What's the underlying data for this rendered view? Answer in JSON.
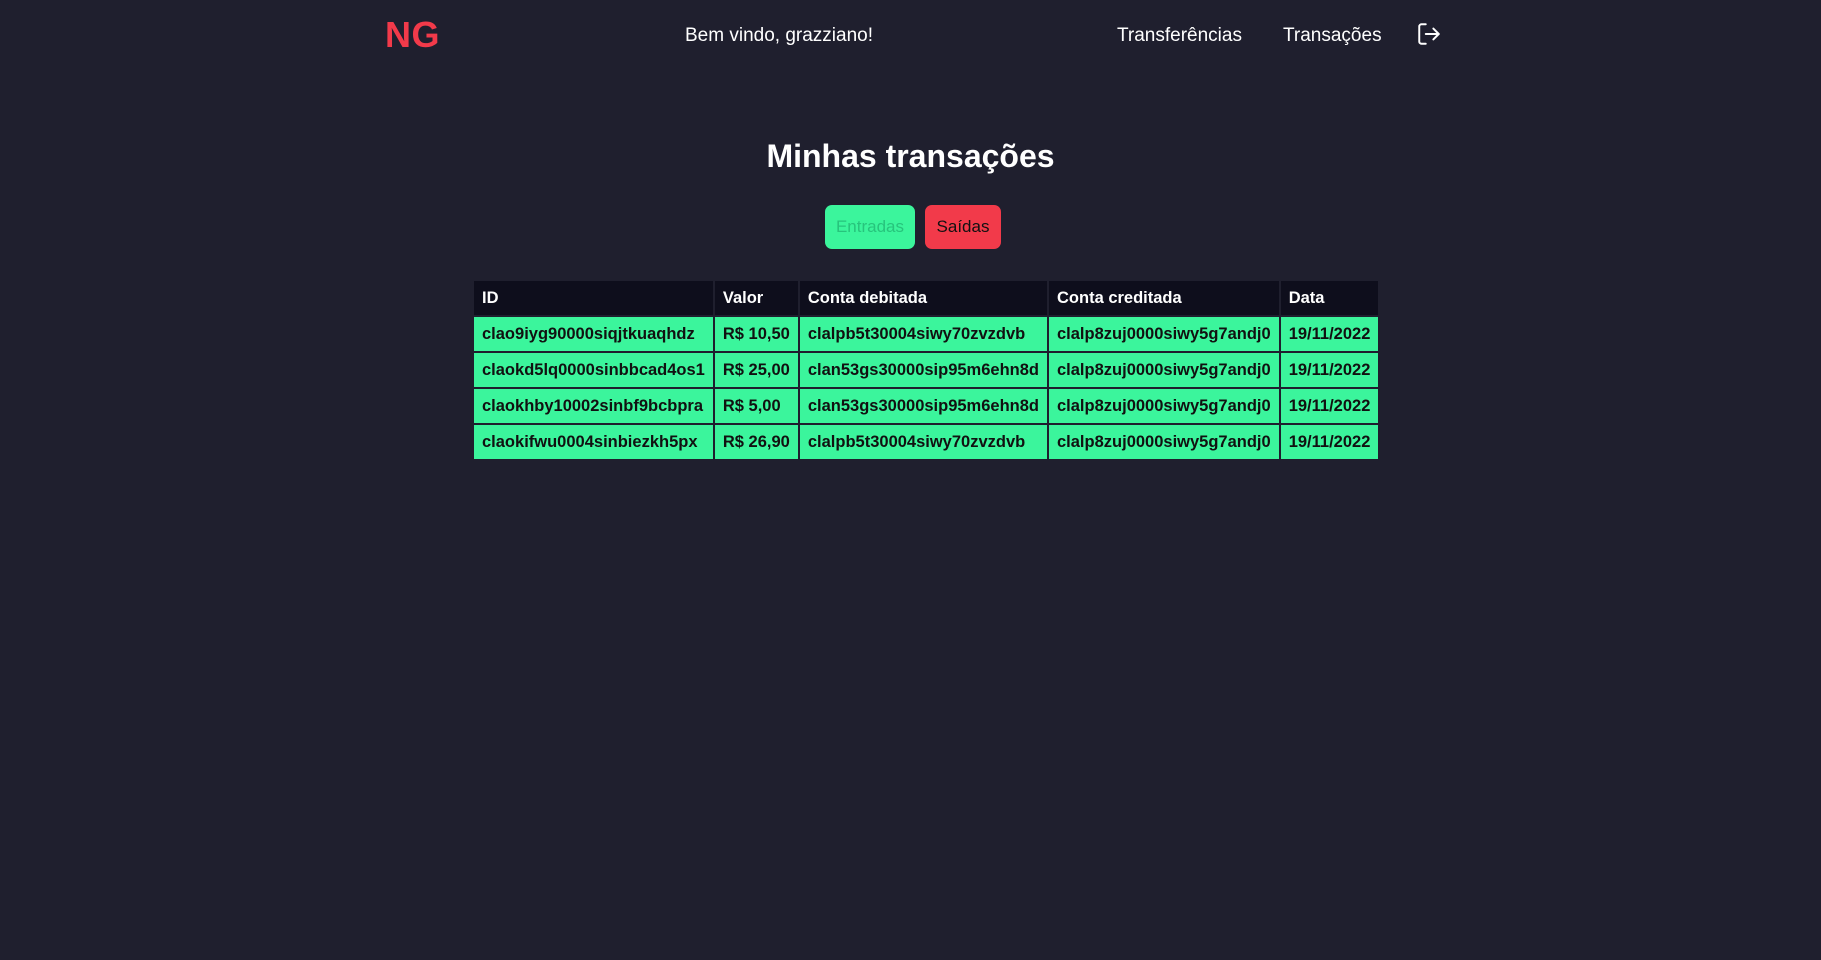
{
  "header": {
    "logo": "NG",
    "welcome": "Bem vindo, grazziano!",
    "nav": {
      "transfers": "Transferências",
      "transactions": "Transações"
    },
    "logout_icon": "logout-icon"
  },
  "main": {
    "title": "Minhas transações",
    "filters": {
      "incoming": "Entradas",
      "outgoing": "Saídas"
    },
    "table": {
      "columns": [
        "ID",
        "Valor",
        "Conta debitada",
        "Conta creditada",
        "Data"
      ],
      "rows": [
        [
          "clao9iyg90000siqjtkuaqhdz",
          "R$ 10,50",
          "clalpb5t30004siwy70zvzdvb",
          "clalp8zuj0000siwy5g7andj0",
          "19/11/2022"
        ],
        [
          "claokd5lq0000sinbbcad4os1",
          "R$ 25,00",
          "clan53gs30000sip95m6ehn8d",
          "clalp8zuj0000siwy5g7andj0",
          "19/11/2022"
        ],
        [
          "claokhby10002sinbf9bcbpra",
          "R$ 5,00",
          "clan53gs30000sip95m6ehn8d",
          "clalp8zuj0000siwy5g7andj0",
          "19/11/2022"
        ],
        [
          "claokifwu0004sinbiezkh5px",
          "R$ 26,90",
          "clalpb5t30004siwy70zvzdvb",
          "clalp8zuj0000siwy5g7andj0",
          "19/11/2022"
        ]
      ]
    }
  },
  "colors": {
    "background": "#1f1f2e",
    "accent_red": "#f23a4a",
    "accent_green": "#3bf59c",
    "table_header": "#0e0e1c"
  }
}
